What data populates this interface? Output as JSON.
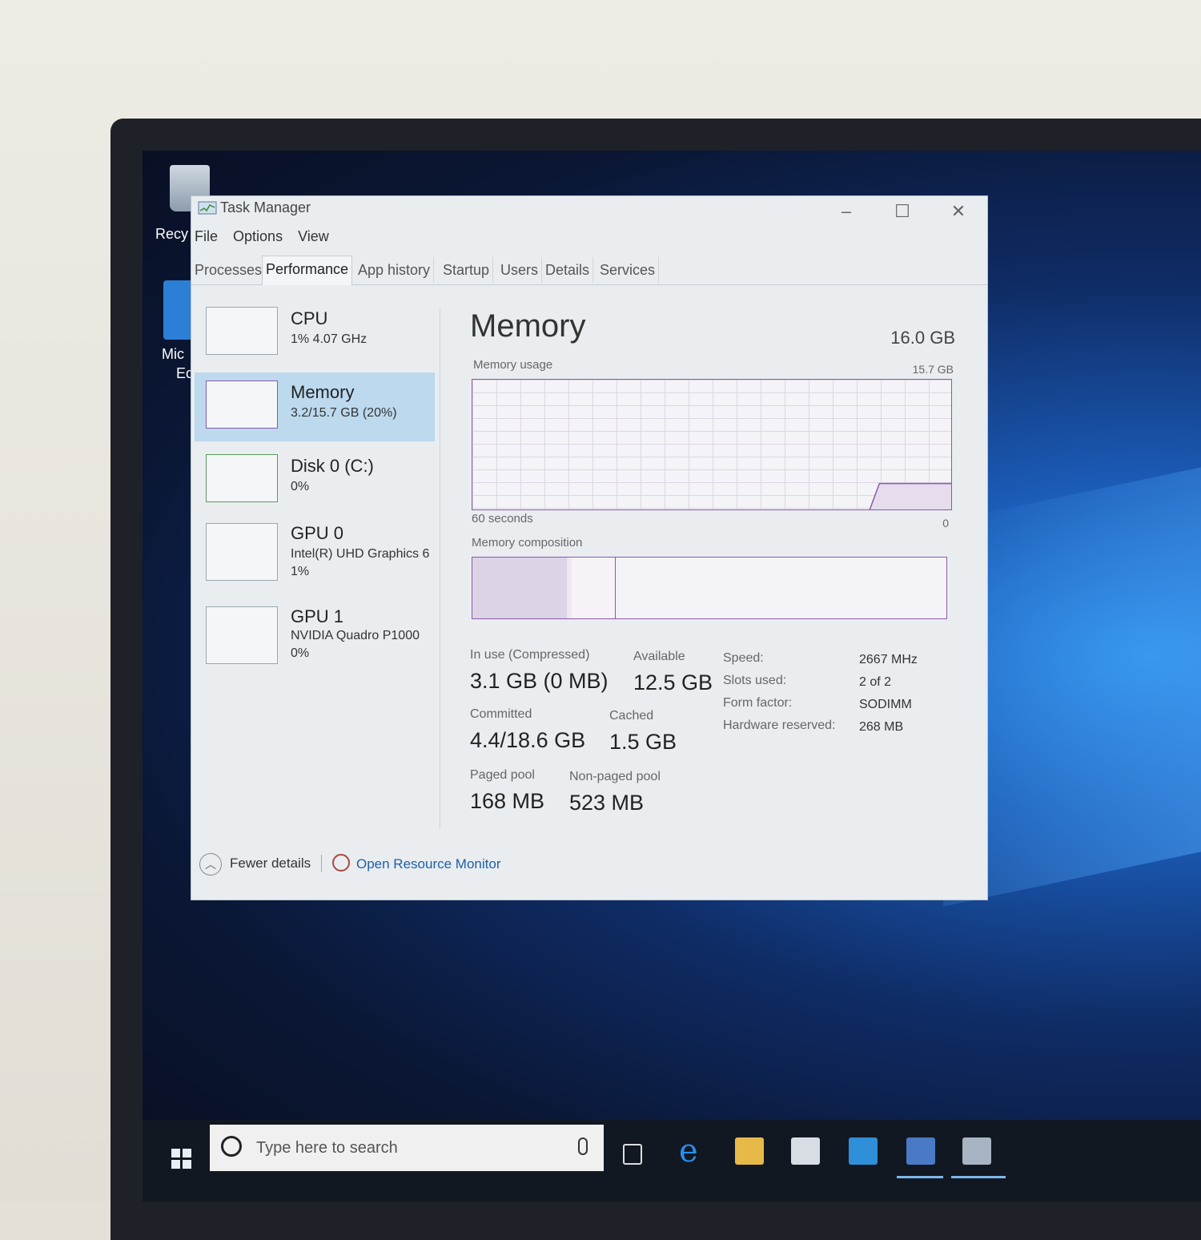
{
  "desktop": {
    "icons": [
      {
        "label": "Recy"
      },
      {
        "label": "Mic"
      },
      {
        "label": "Ec"
      }
    ]
  },
  "window": {
    "title": "Task Manager",
    "controls": {
      "minimize": "–",
      "maximize": "☐",
      "close": "✕"
    }
  },
  "menu": [
    "File",
    "Options",
    "View"
  ],
  "tabs": [
    "Processes",
    "Performance",
    "App history",
    "Startup",
    "Users",
    "Details",
    "Services"
  ],
  "active_tab": "Performance",
  "sidebar": [
    {
      "title": "CPU",
      "sub1": "1% 4.07 GHz",
      "sub2": ""
    },
    {
      "title": "Memory",
      "sub1": "3.2/15.7 GB (20%)",
      "sub2": ""
    },
    {
      "title": "Disk 0 (C:)",
      "sub1": "0%",
      "sub2": ""
    },
    {
      "title": "GPU 0",
      "sub1": "Intel(R) UHD Graphics 6",
      "sub2": "1%"
    },
    {
      "title": "GPU 1",
      "sub1": "NVIDIA Quadro P1000",
      "sub2": "0%"
    }
  ],
  "memory": {
    "title": "Memory",
    "total": "16.0 GB",
    "usage_label": "Memory usage",
    "usage_max": "15.7 GB",
    "time_left": "60 seconds",
    "time_right": "0",
    "composition_label": "Memory composition",
    "in_use_label": "In use (Compressed)",
    "in_use_value": "3.1 GB (0 MB)",
    "available_label": "Available",
    "available_value": "12.5 GB",
    "committed_label": "Committed",
    "committed_value": "4.4/18.6 GB",
    "cached_label": "Cached",
    "cached_value": "1.5 GB",
    "paged_label": "Paged pool",
    "paged_value": "168 MB",
    "nonpaged_label": "Non-paged pool",
    "nonpaged_value": "523 MB",
    "speed_label": "Speed:",
    "speed_value": "2667 MHz",
    "slots_label": "Slots used:",
    "slots_value": "2 of 2",
    "form_label": "Form factor:",
    "form_value": "SODIMM",
    "hw_label": "Hardware reserved:",
    "hw_value": "268 MB",
    "usage_fraction": 0.2,
    "composition": {
      "in_use_fraction": 0.2,
      "modified_fraction": 0.01,
      "standby_fraction": 0.09
    }
  },
  "footer": {
    "fewer_details": "Fewer details",
    "open_resource_monitor": "Open Resource Monitor"
  },
  "taskbar": {
    "search_placeholder": "Type here to search",
    "apps": [
      "task-view-icon",
      "edge-icon",
      "file-explorer-icon",
      "store-icon",
      "mail-icon",
      "remote-desktop-icon",
      "task-manager-icon"
    ]
  },
  "colors": {
    "memory_accent": "#8b5aa8",
    "selection": "#bcd9ee",
    "link": "#1f5fa8"
  }
}
